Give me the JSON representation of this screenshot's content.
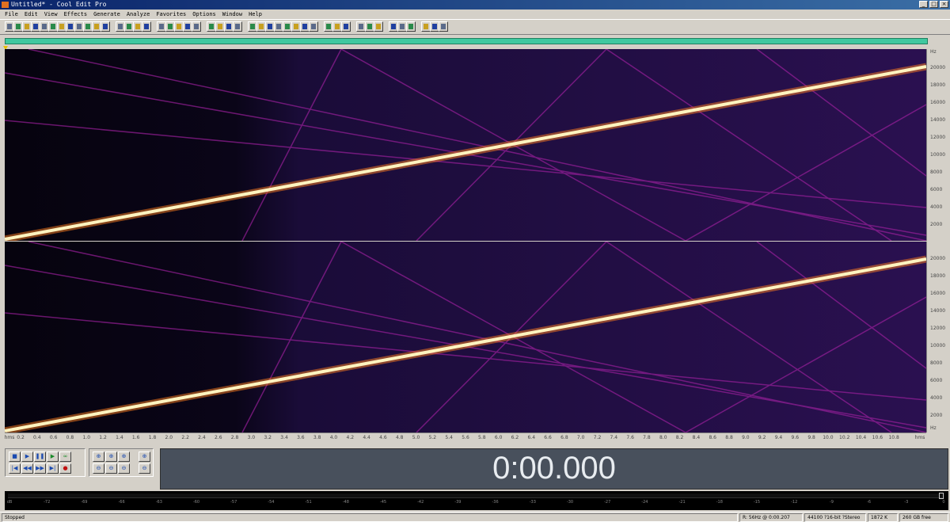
{
  "window": {
    "title": "Untitled* - Cool Edit Pro"
  },
  "menu": [
    "File",
    "Edit",
    "View",
    "Effects",
    "Generate",
    "Analyze",
    "Favorites",
    "Options",
    "Window",
    "Help"
  ],
  "toolbar": {
    "button_count": 45
  },
  "frequency_axis": {
    "unit": "Hz",
    "labels": [
      "20000",
      "18000",
      "16000",
      "14000",
      "12000",
      "10000",
      "8000",
      "6000",
      "4000",
      "2000"
    ]
  },
  "time_axis": {
    "start_label": "hms",
    "end_label": "hms",
    "labels": [
      "0.2",
      "0.4",
      "0.6",
      "0.8",
      "1.0",
      "1.2",
      "1.4",
      "1.6",
      "1.8",
      "2.0",
      "2.2",
      "2.4",
      "2.6",
      "2.8",
      "3.0",
      "3.2",
      "3.4",
      "3.6",
      "3.8",
      "4.0",
      "4.2",
      "4.4",
      "4.6",
      "4.8",
      "5.0",
      "5.2",
      "5.4",
      "5.6",
      "5.8",
      "6.0",
      "6.2",
      "6.4",
      "6.6",
      "6.8",
      "7.0",
      "7.2",
      "7.4",
      "7.6",
      "7.8",
      "8.0",
      "8.2",
      "8.4",
      "8.6",
      "8.8",
      "9.0",
      "9.2",
      "9.4",
      "9.6",
      "9.8",
      "10.0",
      "10.2",
      "10.4",
      "10.6",
      "10.8"
    ]
  },
  "transport": {
    "row1": [
      "■",
      "▶",
      "❚❚",
      "▶",
      "∞"
    ],
    "row2": [
      "|◀",
      "◀◀",
      "▶▶",
      "▶|",
      "●"
    ]
  },
  "zoom": {
    "row1": [
      "⊕",
      "⊕",
      "⊕",
      "⊕"
    ],
    "row2": [
      "⊖",
      "⊖",
      "⊖",
      "⊖"
    ]
  },
  "time_display": "0:00.000",
  "level_meter": {
    "labels": [
      "dB",
      "-72",
      "-69",
      "-66",
      "-63",
      "-60",
      "-57",
      "-54",
      "-51",
      "-48",
      "-45",
      "-42",
      "-39",
      "-36",
      "-33",
      "-30",
      "-27",
      "-24",
      "-21",
      "-18",
      "-15",
      "-12",
      "-9",
      "-6",
      "-3",
      "0"
    ]
  },
  "status": {
    "state": "Stopped",
    "cursor": "R: 56Hz @ 0:00.207",
    "format": "44100 ?16-bit ?Stereo",
    "size": "1872 K",
    "free": "260 GB free"
  },
  "colors": {
    "spectrogram_bg": "#0c0620",
    "sweep": "#fff4c0",
    "harmonics": "#a020a0",
    "time_panel": "#48505c",
    "overview": "#40c8a0"
  }
}
